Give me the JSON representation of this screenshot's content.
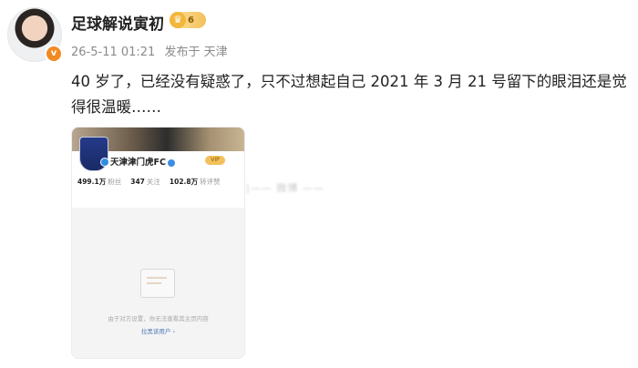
{
  "post": {
    "author": "足球解说寅初",
    "vip_label": "6",
    "meta_time": "26-5-11 01:21",
    "meta_location": "发布于 天津",
    "text": "40 岁了，已经没有疑惑了，只不过想起自己 2021 年 3 月 21 号留下的眼泪还是觉得很温暖……"
  },
  "card": {
    "team_name": "天津津门虎FC",
    "vip_tag": "VIP",
    "stats": [
      {
        "value": "499.1万",
        "label": "粉丝"
      },
      {
        "value": "347",
        "label": "关注"
      },
      {
        "value": "102.8万",
        "label": "转评赞"
      }
    ],
    "empty_text": "由于对方设置，你无法查看其主页内容",
    "empty_link": "拉黑该用户 ›"
  },
  "side_note": "|—— 微博 ——"
}
